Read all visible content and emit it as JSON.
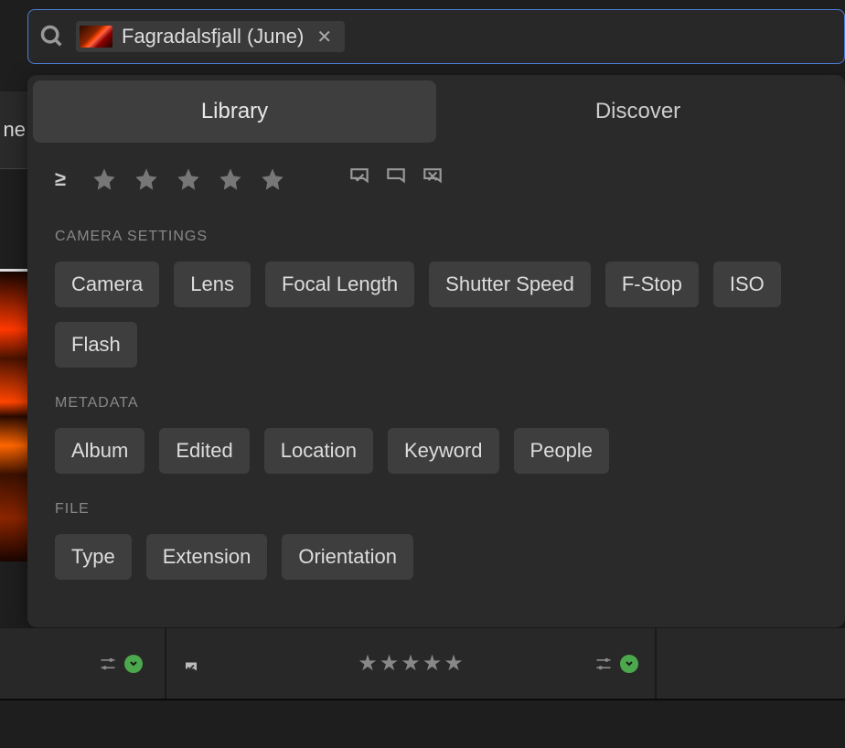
{
  "search": {
    "tag_label": "Fagradalsfjall (June)"
  },
  "left_text": "ne",
  "tabs": {
    "library": "Library",
    "discover": "Discover"
  },
  "sections": {
    "camera_settings": {
      "title": "CAMERA SETTINGS",
      "chips": [
        "Camera",
        "Lens",
        "Focal Length",
        "Shutter Speed",
        "F-Stop",
        "ISO",
        "Flash"
      ]
    },
    "metadata": {
      "title": "METADATA",
      "chips": [
        "Album",
        "Edited",
        "Location",
        "Keyword",
        "People"
      ]
    },
    "file": {
      "title": "FILE",
      "chips": [
        "Type",
        "Extension",
        "Orientation"
      ]
    }
  }
}
